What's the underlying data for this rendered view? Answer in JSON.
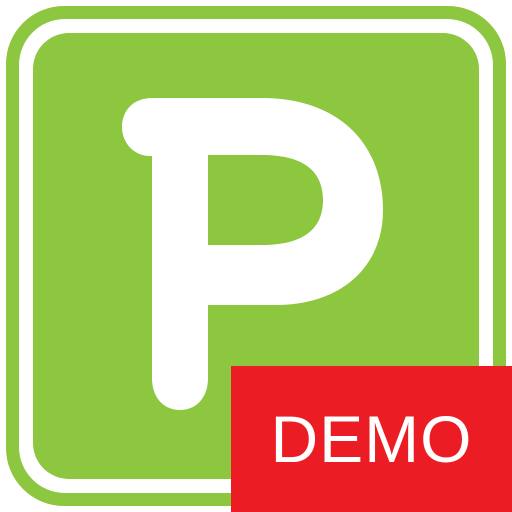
{
  "app_icon": {
    "letter": "P",
    "badge_label": "DEMO"
  },
  "colors": {
    "brand_green": "#8dc63f",
    "badge_red": "#ec1c24",
    "foreground": "#ffffff",
    "background": "#ffffff"
  },
  "icons": {
    "logo": "letter-p-logo-icon"
  }
}
